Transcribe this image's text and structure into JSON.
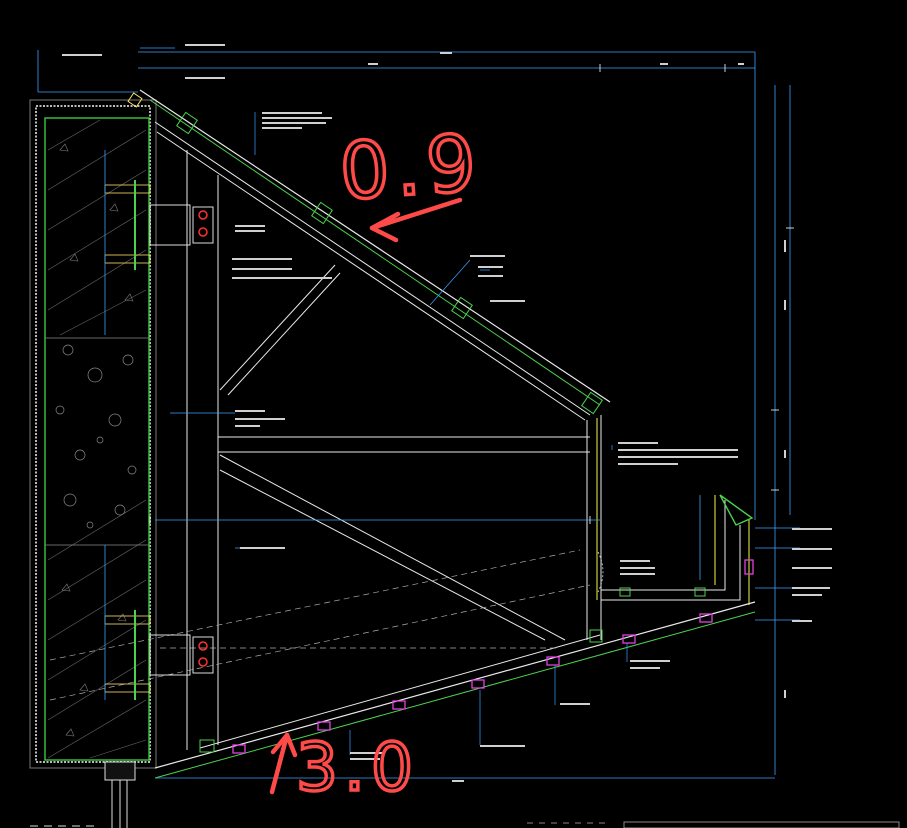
{
  "annotations": {
    "top_value": "0.9",
    "bottom_value": "3.0"
  },
  "colors": {
    "background": "#000000",
    "annotation": "#ff4a4a",
    "wall": "#4cd24c",
    "frame": "#ffffff",
    "bracket": "#e040e0",
    "glass": "#f5f548",
    "dim_line": "#3aa0ff"
  }
}
